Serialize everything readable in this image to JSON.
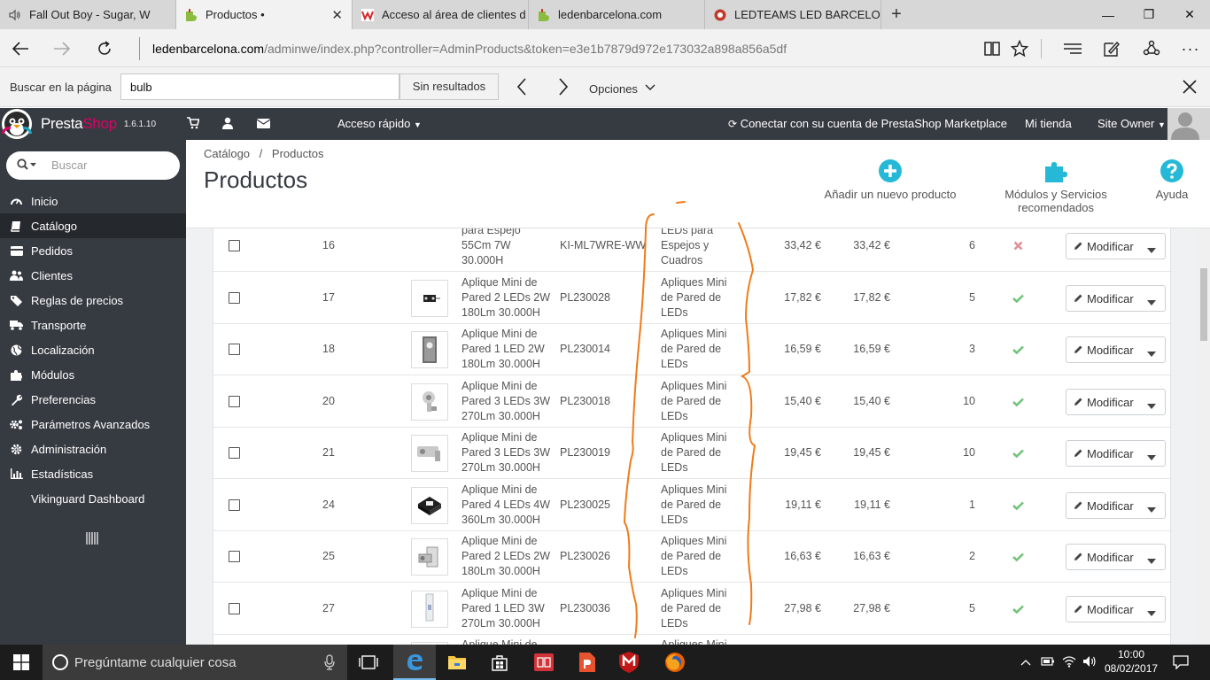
{
  "browser": {
    "tabs": [
      {
        "title": "Fall Out Boy - Sugar, W",
        "icon": "speaker-icon"
      },
      {
        "title": "Productos •",
        "icon": "prestashop-icon"
      },
      {
        "title": "Acceso al área de clientes d",
        "icon": "w-brand-icon"
      },
      {
        "title": "ledenbarcelona.com",
        "icon": "prestashop-icon"
      },
      {
        "title": "LEDTEAMS LED BARCELON/",
        "icon": "ledteams-icon"
      }
    ],
    "active_tab": 1,
    "new_tab_label": "+",
    "url_domain": "ledenbarcelona.com",
    "url_path": "/adminwe/index.php?controller=AdminProducts&token=e3e1b7879d972e173032a898a856a5df"
  },
  "findbar": {
    "label": "Buscar en la página",
    "query": "bulb",
    "result": "Sin resultados",
    "options": "Opciones"
  },
  "header": {
    "logo_presta": "Presta",
    "logo_shop": "Shop",
    "version": "1.6.1.10",
    "quick_access": "Acceso rápido",
    "connect": "Conectar con su cuenta de PrestaShop Marketplace",
    "my_store": "Mi tienda",
    "owner": "Site Owner"
  },
  "sidebar": {
    "search_placeholder": "Buscar",
    "items": [
      {
        "label": "Inicio",
        "icon": "dashboard-icon"
      },
      {
        "label": "Catálogo",
        "icon": "book-icon",
        "active": true
      },
      {
        "label": "Pedidos",
        "icon": "credit-card-icon"
      },
      {
        "label": "Clientes",
        "icon": "users-icon"
      },
      {
        "label": "Reglas de precios",
        "icon": "tags-icon"
      },
      {
        "label": "Transporte",
        "icon": "truck-icon"
      },
      {
        "label": "Localización",
        "icon": "globe-icon"
      },
      {
        "label": "Módulos",
        "icon": "puzzle-icon"
      },
      {
        "label": "Preferencias",
        "icon": "wrench-icon"
      },
      {
        "label": "Parámetros Avanzados",
        "icon": "cogs-icon"
      },
      {
        "label": "Administración",
        "icon": "cog-icon"
      },
      {
        "label": "Estadísticas",
        "icon": "bar-chart-icon"
      },
      {
        "label": "Vikinguard Dashboard",
        "icon": ""
      }
    ]
  },
  "page": {
    "breadcrumb_1": "Catálogo",
    "breadcrumb_sep": "/",
    "breadcrumb_2": "Productos",
    "title": "Productos",
    "toolbar": {
      "add_product": "Añadir un nuevo producto",
      "modules": "Módulos y Servicios recomendados",
      "help": "Ayuda"
    }
  },
  "table": {
    "action_label": "Modificar",
    "rows": [
      {
        "id": "16",
        "name": [
          "para Espejo",
          "55Cm 7W",
          "30.000H"
        ],
        "ref": "KI-ML7WRE-WW",
        "category": [
          "LEDs para",
          "Espejos y",
          "Cuadros"
        ],
        "price": "33,42 €",
        "price_tax": "33,42 €",
        "qty": "6",
        "active": false,
        "thumb": "none"
      },
      {
        "id": "17",
        "name": [
          "Aplique Mini de",
          "Pared 2 LEDs 2W",
          "180Lm 30.000H"
        ],
        "ref": "PL230028",
        "category": [
          "Apliques Mini",
          "de Pared de",
          "LEDs"
        ],
        "price": "17,82 €",
        "price_tax": "17,82 €",
        "qty": "5",
        "active": true,
        "thumb": "a"
      },
      {
        "id": "18",
        "name": [
          "Aplique Mini de",
          "Pared 1 LED 2W",
          "180Lm 30.000H"
        ],
        "ref": "PL230014",
        "category": [
          "Apliques Mini",
          "de Pared de",
          "LEDs"
        ],
        "price": "16,59 €",
        "price_tax": "16,59 €",
        "qty": "3",
        "active": true,
        "thumb": "b"
      },
      {
        "id": "20",
        "name": [
          "Aplique Mini de",
          "Pared 3 LEDs 3W",
          "270Lm 30.000H"
        ],
        "ref": "PL230018",
        "category": [
          "Apliques Mini",
          "de Pared de",
          "LEDs"
        ],
        "price": "15,40 €",
        "price_tax": "15,40 €",
        "qty": "10",
        "active": true,
        "thumb": "c"
      },
      {
        "id": "21",
        "name": [
          "Aplique Mini de",
          "Pared 3 LEDs 3W",
          "270Lm 30.000H"
        ],
        "ref": "PL230019",
        "category": [
          "Apliques Mini",
          "de Pared de",
          "LEDs"
        ],
        "price": "19,45 €",
        "price_tax": "19,45 €",
        "qty": "10",
        "active": true,
        "thumb": "d"
      },
      {
        "id": "24",
        "name": [
          "Aplique Mini de",
          "Pared 4 LEDs 4W",
          "360Lm 30.000H"
        ],
        "ref": "PL230025",
        "category": [
          "Apliques Mini",
          "de Pared de",
          "LEDs"
        ],
        "price": "19,11 €",
        "price_tax": "19,11 €",
        "qty": "1",
        "active": true,
        "thumb": "e"
      },
      {
        "id": "25",
        "name": [
          "Aplique Mini de",
          "Pared 2 LEDs 2W",
          "180Lm 30.000H"
        ],
        "ref": "PL230026",
        "category": [
          "Apliques Mini",
          "de Pared de",
          "LEDs"
        ],
        "price": "16,63 €",
        "price_tax": "16,63 €",
        "qty": "2",
        "active": true,
        "thumb": "f"
      },
      {
        "id": "27",
        "name": [
          "Aplique Mini de",
          "Pared 1 LED 3W",
          "270Lm 30.000H"
        ],
        "ref": "PL230036",
        "category": [
          "Apliques Mini",
          "de Pared de",
          "LEDs"
        ],
        "price": "27,98 €",
        "price_tax": "27,98 €",
        "qty": "5",
        "active": true,
        "thumb": "g"
      },
      {
        "id": "",
        "name": [
          "Aplique Mini de",
          "",
          ""
        ],
        "ref": "",
        "category": [
          "Apliques Mini",
          "",
          ""
        ],
        "price": "",
        "price_tax": "",
        "qty": "",
        "active": null,
        "thumb": "h"
      }
    ]
  },
  "annotation_color": "#f07b1a",
  "taskbar": {
    "search_placeholder": "Pregúntame cualquier cosa",
    "time": "10:00",
    "date": "08/02/2017"
  }
}
